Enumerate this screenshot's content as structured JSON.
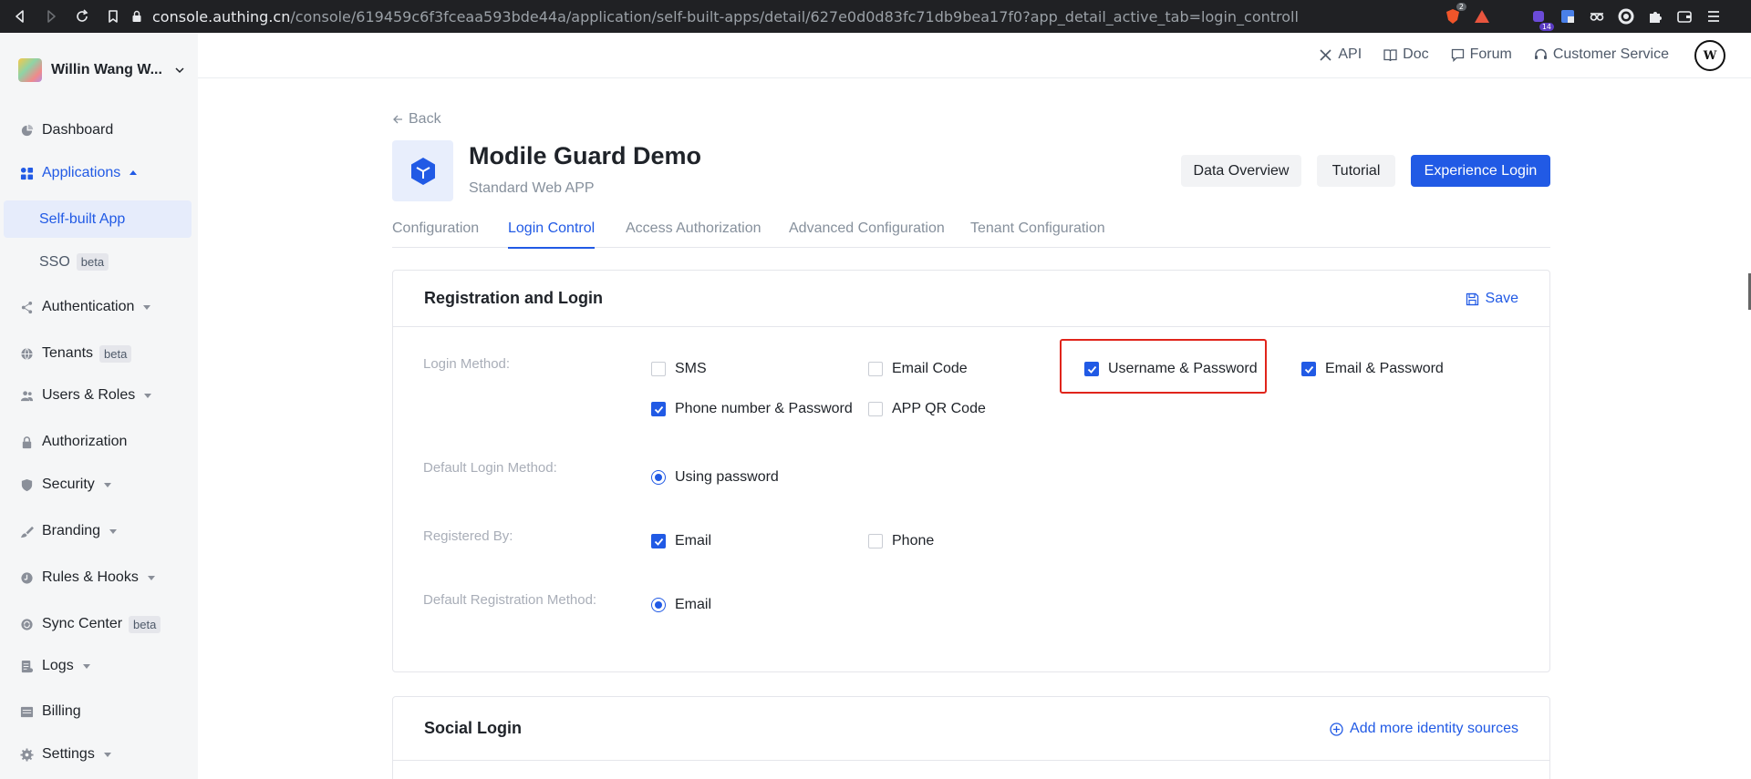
{
  "browser": {
    "url_host": "console.authing.cn",
    "url_path": "/console/619459c6f3fceaa593bde44a/application/self-built-apps/detail/627e0d0d83fc71db9bea17f0?app_detail_active_tab=login_controll",
    "ext_badge_1": "2",
    "ext_badge_2": "14"
  },
  "sidebar": {
    "org_name": "Willin Wang W...",
    "items": [
      {
        "label": "Dashboard",
        "icon": "pie-chart-icon"
      },
      {
        "label": "Applications",
        "icon": "apps-icon"
      },
      {
        "label": "Self-built App"
      },
      {
        "label": "SSO",
        "badge": "beta"
      },
      {
        "label": "Authentication",
        "icon": "share-icon"
      },
      {
        "label": "Tenants",
        "badge": "beta",
        "icon": "globe-icon"
      },
      {
        "label": "Users & Roles",
        "icon": "users-icon"
      },
      {
        "label": "Authorization",
        "icon": "lock-icon"
      },
      {
        "label": "Security",
        "icon": "shield-icon"
      },
      {
        "label": "Branding",
        "icon": "brush-icon"
      },
      {
        "label": "Rules & Hooks",
        "icon": "hook-icon"
      },
      {
        "label": "Sync Center",
        "badge": "beta",
        "icon": "sync-icon"
      },
      {
        "label": "Logs",
        "icon": "log-icon"
      },
      {
        "label": "Billing",
        "icon": "billing-icon"
      },
      {
        "label": "Settings",
        "icon": "gear-icon"
      }
    ]
  },
  "topbar": {
    "api": "API",
    "doc": "Doc",
    "forum": "Forum",
    "customer_service": "Customer Service"
  },
  "header": {
    "back": "Back",
    "app_title": "Modile Guard Demo",
    "app_subtitle": "Standard Web APP",
    "data_overview": "Data Overview",
    "tutorial": "Tutorial",
    "experience_login": "Experience Login"
  },
  "tabs": [
    "Configuration",
    "Login Control",
    "Access Authorization",
    "Advanced Configuration",
    "Tenant Configuration"
  ],
  "registration": {
    "title": "Registration and Login",
    "save": "Save",
    "login_method_label": "Login Method:",
    "login_methods": [
      {
        "label": "SMS",
        "checked": false
      },
      {
        "label": "Email Code",
        "checked": false
      },
      {
        "label": "Username & Password",
        "checked": true
      },
      {
        "label": "Email & Password",
        "checked": true
      },
      {
        "label": "Phone number & Password",
        "checked": true
      },
      {
        "label": "APP QR Code",
        "checked": false
      }
    ],
    "default_login_label": "Default Login Method:",
    "default_login_value": "Using password",
    "registered_by_label": "Registered By:",
    "registered_by": [
      {
        "label": "Email",
        "checked": true
      },
      {
        "label": "Phone",
        "checked": false
      }
    ],
    "default_registration_label": "Default Registration Method:",
    "default_registration_value": "Email"
  },
  "social": {
    "title": "Social Login",
    "add_more": "Add more identity sources"
  },
  "colors": {
    "primary": "#215ae5",
    "highlight": "#e0241b",
    "sidebar_bg": "#f5f6f7"
  }
}
